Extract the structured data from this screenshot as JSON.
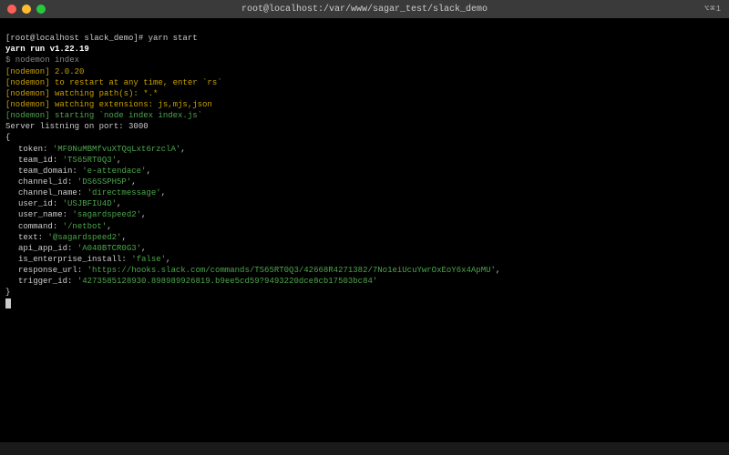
{
  "titlebar": {
    "title": "root@localhost:/var/www/sagar_test/slack_demo",
    "right_indicator": "⌥⌘1"
  },
  "prompt": {
    "text": "[root@localhost slack_demo]# yarn start"
  },
  "yarn_line": "yarn run v1.22.19",
  "nodemon_cmd": "$ nodemon index",
  "nodemon": [
    "[nodemon] 2.0.20",
    "[nodemon] to restart at any time, enter `rs`",
    "[nodemon] watching path(s): *.*",
    "[nodemon] watching extensions: js,mjs,json",
    "[nodemon] starting `node index index.js`"
  ],
  "listen_line": "Server listning on port: 3000",
  "payload": {
    "open": "{",
    "close": "}",
    "entries": [
      {
        "k": "token",
        "v": "'MF0NuMBMfvuXTQqLxt6rzclA'"
      },
      {
        "k": "team_id",
        "v": "'TS65RT0Q3'"
      },
      {
        "k": "team_domain",
        "v": "'e-attendace'"
      },
      {
        "k": "channel_id",
        "v": "'DS6SSPH5P'"
      },
      {
        "k": "channel_name",
        "v": "'directmessage'"
      },
      {
        "k": "user_id",
        "v": "'USJBFIU4D'"
      },
      {
        "k": "user_name",
        "v": "'sagardspeed2'"
      },
      {
        "k": "command",
        "v": "'/netbot'"
      },
      {
        "k": "text",
        "v": "'@sagardspeed2'"
      },
      {
        "k": "api_app_id",
        "v": "'A040BTCR0G3'"
      },
      {
        "k": "is_enterprise_install",
        "v": "'false'"
      },
      {
        "k": "response_url",
        "v": "'https://hooks.slack.com/commands/TS65RT0Q3/42668R4271382/7No1eiUcuYwrOxEoY6x4ApMU'"
      },
      {
        "k": "trigger_id",
        "v": "'4273585128930.898989926819.b9ee5cd59?9493220dce8cb17503bc84'"
      }
    ]
  }
}
